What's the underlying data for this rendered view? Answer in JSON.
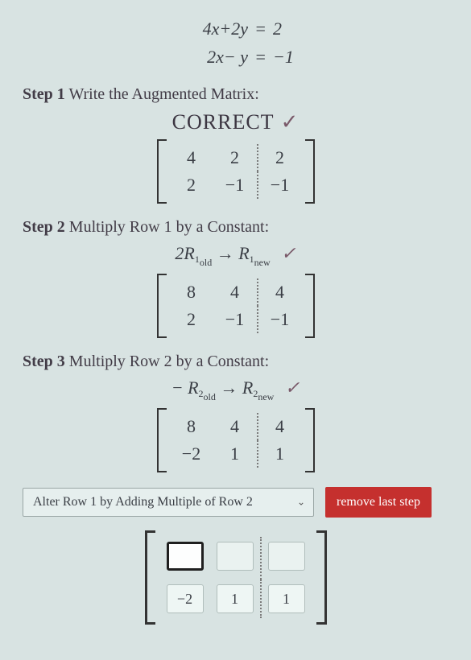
{
  "system": {
    "rows": [
      {
        "lhs": "4x+2y",
        "rhs": "2"
      },
      {
        "lhs": "2x−  y",
        "rhs": "−1"
      }
    ],
    "eq": "="
  },
  "steps": {
    "s1": {
      "label_prefix": "Step 1",
      "label": "Write the Augmented Matrix:",
      "correct": "CORRECT",
      "check": "✓",
      "matrix": [
        [
          "4",
          "2",
          "2"
        ],
        [
          "2",
          "−1",
          "−1"
        ]
      ]
    },
    "s2": {
      "label_prefix": "Step 2",
      "label": "Multiply Row 1 by a Constant:",
      "op_lhs_coef": "2",
      "op_lhs": "R",
      "op_lhs_idx": "1",
      "op_lhs_sub": "old",
      "arrow": "→",
      "op_rhs": "R",
      "op_rhs_idx": "1",
      "op_rhs_sub": "new",
      "check": "✓",
      "matrix": [
        [
          "8",
          "4",
          "4"
        ],
        [
          "2",
          "−1",
          "−1"
        ]
      ]
    },
    "s3": {
      "label_prefix": "Step 3",
      "label": "Multiply Row 2 by a Constant:",
      "op_lhs_coef": "−",
      "op_lhs": "R",
      "op_lhs_idx": "2",
      "op_lhs_sub": "old",
      "arrow": "→",
      "op_rhs": "R",
      "op_rhs_idx": "2",
      "op_rhs_sub": "new",
      "check": "✓",
      "matrix": [
        [
          "8",
          "4",
          "4"
        ],
        [
          "−2",
          "1",
          "1"
        ]
      ]
    }
  },
  "controls": {
    "dropdown_selected": "Alter Row 1 by Adding Multiple of Row 2",
    "remove_label": "remove last step"
  },
  "input_matrix": {
    "row1": {
      "c1": "",
      "c2": "",
      "c3": ""
    },
    "row2": {
      "c1": "−2",
      "c2": "1",
      "c3": "1"
    }
  }
}
